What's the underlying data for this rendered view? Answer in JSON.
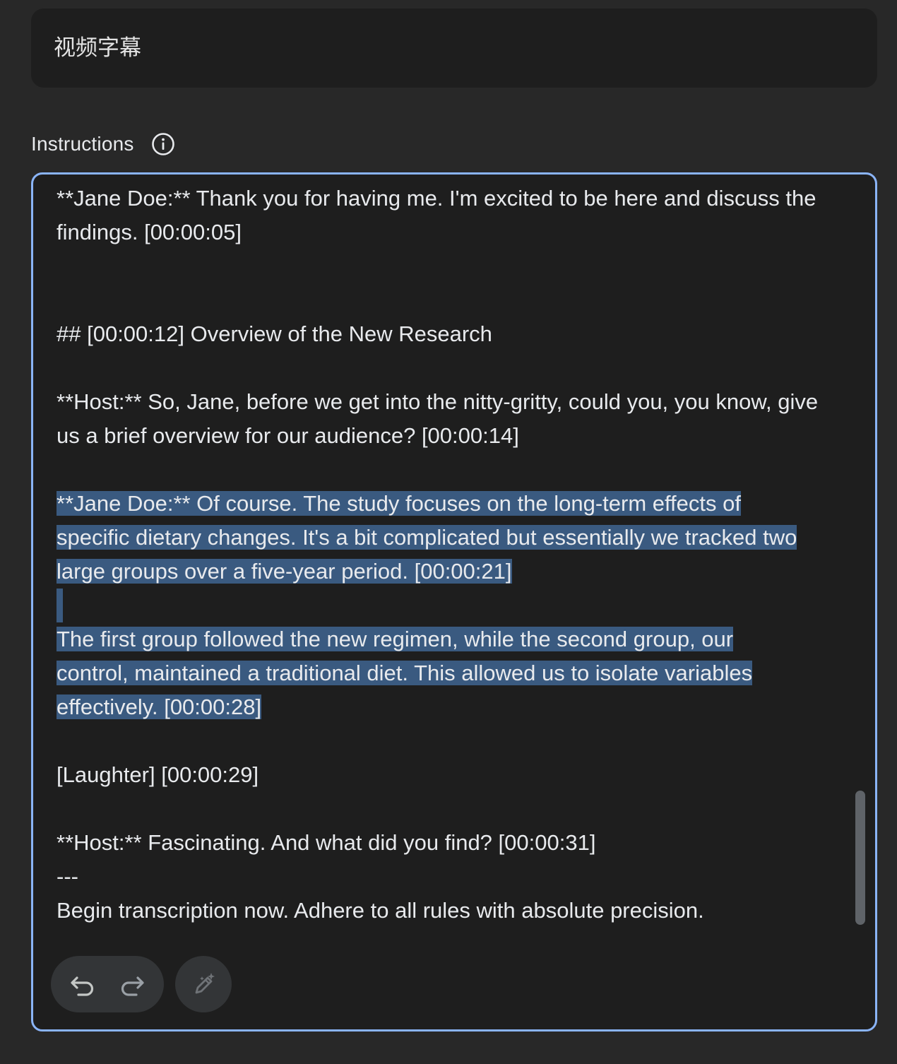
{
  "title_field": {
    "value": "视频字幕"
  },
  "instructions": {
    "label": "Instructions",
    "info_icon": "info-icon"
  },
  "editor": {
    "lines": [
      "**Jane Doe:** Thank you for having me. I'm excited to be here and discuss the findings. [00:00:05]",
      "## [00:00:12] Overview of the New Research",
      "**Host:** So, Jane, before we get into the nitty-gritty, could you, you know, give us a brief overview for our audience? [00:00:14]",
      "**Jane Doe:** Of course. The study focuses on the long-term effects of specific dietary changes. It's a bit complicated but essentially we tracked two large groups over a five-year period. [00:00:21]",
      "The first group followed the new regimen, while the second group, our control, maintained a traditional diet. This allowed us to isolate variables effectively. [00:00:28]",
      "[Laughter] [00:00:29]",
      "**Host:** Fascinating. And what did you find? [00:00:31]",
      "---",
      "Begin transcription now. Adhere to all rules with absolute precision."
    ],
    "selection_color": "#3a5a80",
    "focus_border_color": "#8ab4f8"
  },
  "toolbar": {
    "undo_icon": "undo-icon",
    "redo_icon": "redo-icon",
    "ai_edit_icon": "magic-pen-icon"
  }
}
